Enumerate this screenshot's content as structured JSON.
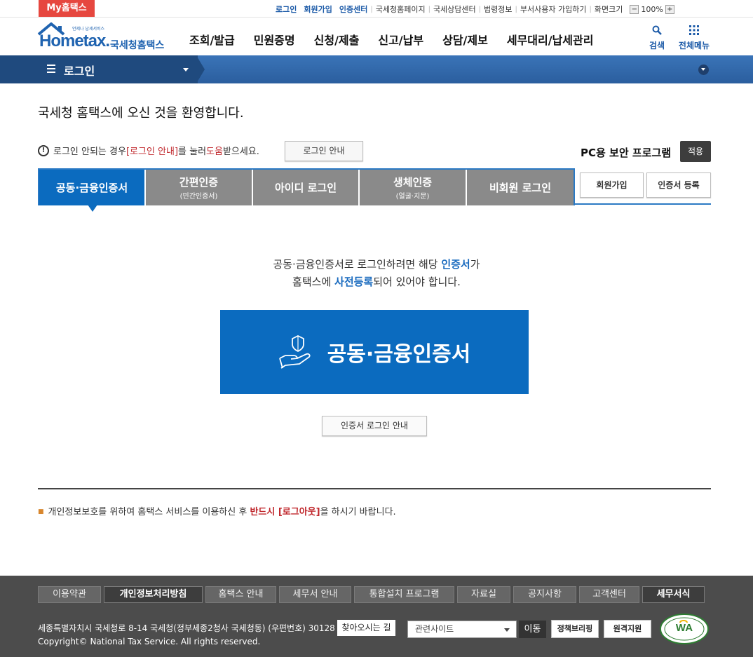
{
  "topbar": {
    "my_hometax": "My홈택스",
    "links": [
      {
        "label": "로그인",
        "emphasis": true
      },
      {
        "label": "회원가입",
        "emphasis": true
      },
      {
        "label": "인증센터",
        "emphasis": true
      },
      {
        "label": "국세청홈페이지",
        "emphasis": false
      },
      {
        "label": "국세상담센터",
        "emphasis": false
      },
      {
        "label": "법령정보",
        "emphasis": false
      },
      {
        "label": "부서사용자 가입하기",
        "emphasis": false
      },
      {
        "label": "화면크기",
        "emphasis": false
      }
    ],
    "zoom_minus": "−",
    "zoom_level": "100%",
    "zoom_plus": "+"
  },
  "header": {
    "logo_tagline": "언제나 납세서비스",
    "logo_word": "Hometax.",
    "logo_korean": "국세청홈택스",
    "nav": [
      "조회/발급",
      "민원증명",
      "신청/제출",
      "신고/납부",
      "상담/제보",
      "세무대리/납세관리"
    ],
    "search_label": "검색",
    "all_menu_label": "전체메뉴"
  },
  "location": {
    "title": "로그인"
  },
  "content": {
    "welcome": "국세청 홈택스에 오신 것을 환영합니다.",
    "notice_icon": "!",
    "notice_prefix": "로그인 안되는 경우 ",
    "notice_highlight1": "[로그인 안내]",
    "notice_middle": "를 눌러 ",
    "notice_highlight2": "도움",
    "notice_suffix": "받으세요.",
    "login_guide_button": "로그인 안내",
    "pc_security_label": "PC용 보안 프로그램",
    "apply_button": "적용",
    "tabs": [
      {
        "label": "공동·금융인증서",
        "sub": "",
        "active": true
      },
      {
        "label": "간편인증",
        "sub": "(민간인증서)",
        "active": false
      },
      {
        "label": "아이디 로그인",
        "sub": "",
        "active": false
      },
      {
        "label": "생체인증",
        "sub": "(얼굴·지문)",
        "active": false
      },
      {
        "label": "비회원 로그인",
        "sub": "",
        "active": false
      }
    ],
    "join_button": "회원가입",
    "cert_register_button": "인증서 등록",
    "desc_line1_prefix": "공동·금융인증서로 로그인하려면 해당 ",
    "desc_line1_highlight": "인증서",
    "desc_line1_suffix": "가",
    "desc_line2_prefix": "홈택스에 ",
    "desc_line2_highlight": "사전등록",
    "desc_line2_suffix": "되어 있어야 합니다.",
    "big_button_label": "공동·금융인증서",
    "cert_login_guide_button": "인증서 로그인 안내",
    "bottom_note_prefix": "개인정보보호를 위하여 홈택스 서비스를 이용하신 후 ",
    "bottom_note_highlight": "반드시 [로그아웃]",
    "bottom_note_suffix": "을 하시기 바랍니다."
  },
  "footer": {
    "links": [
      {
        "label": "이용약관",
        "highlight": false
      },
      {
        "label": "개인정보처리방침",
        "highlight": true
      },
      {
        "label": "홈택스 안내",
        "highlight": false
      },
      {
        "label": "세무서 안내",
        "highlight": false
      },
      {
        "label": "통합설치 프로그램",
        "highlight": false
      },
      {
        "label": "자료실",
        "highlight": false
      },
      {
        "label": "공지사항",
        "highlight": false
      },
      {
        "label": "고객센터",
        "highlight": false
      },
      {
        "label": "세무서식",
        "highlight": true
      }
    ],
    "address": "세종특별자치시 국세청로 8-14 국세청(정부세종2청사 국세청동) (우편번호) 30128",
    "find_way_button": "찾아오시는 길",
    "copyright": "Copyright© National Tax Service. All rights reserved.",
    "related_sites_select": "관련사이트",
    "move_button": "이동",
    "policy_briefing": "정책브리핑",
    "remote_support": "원격지원",
    "wa_mark": "WA"
  },
  "colors": {
    "brand_blue": "#0b6bbf",
    "my_hometax_red": "#e6473f",
    "location_bar": "#2b5e9e",
    "footer_bg": "#4c4c4c",
    "highlight_red": "#c0282d"
  }
}
